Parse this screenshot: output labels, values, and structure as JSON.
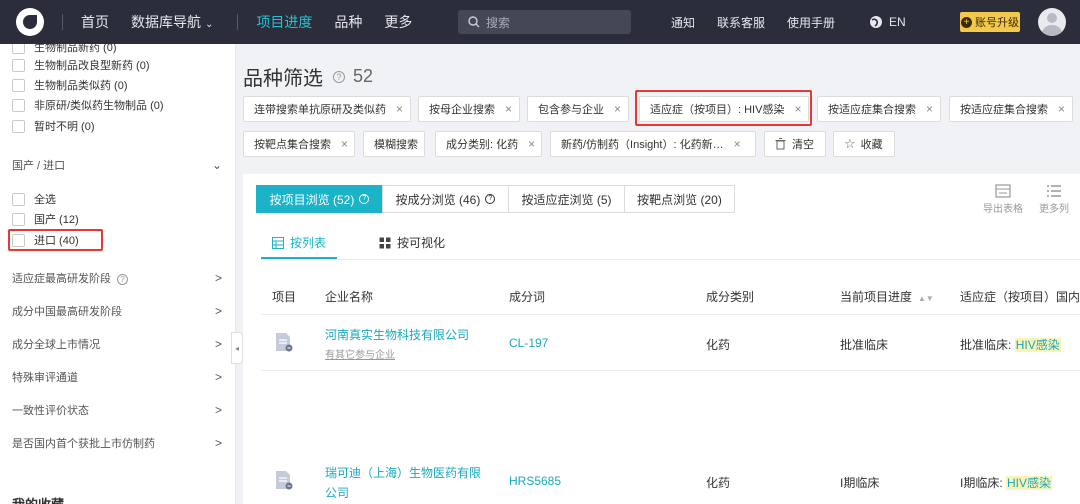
{
  "nav": {
    "items": [
      "首页",
      "数据库导航",
      "项目进度",
      "品种",
      "更多"
    ],
    "search_placeholder": "搜索",
    "right": [
      "通知",
      "联系客服",
      "使用手册"
    ],
    "lang": "EN",
    "upgrade": "账号升级"
  },
  "sidebar": {
    "checkbox_items_top": [
      "生物制品新药 (0)",
      "生物制品改良型新药 (0)",
      "生物制品类似药 (0)",
      "非原研/类似药生物制品 (0)",
      "暂时不明 (0)"
    ],
    "origin_section": "国产 / 进口",
    "origin_items": [
      "全选",
      "国产 (12)",
      "进口 (40)"
    ],
    "sections": [
      "适应症最高研发阶段",
      "成分中国最高研发阶段",
      "成分全球上市情况",
      "特殊审评通道",
      "一致性评价状态",
      "是否国内首个获批上市仿制药"
    ],
    "bottom_partial": "我的收藏"
  },
  "main": {
    "title": "品种筛选",
    "count": "52",
    "tags_row1": [
      "连带搜索单抗原研及类似药",
      "按母企业搜索",
      "包含参与企业",
      "适应症（按项目）: HIV感染",
      "按适应症集合搜索",
      "按适应症集合搜索"
    ],
    "tags_row2": [
      "按靶点集合搜索",
      "模糊搜索",
      "成分类别: 化药",
      "新药/仿制药（Insight）: 化药新…"
    ],
    "clear": "清空",
    "favorite": "收藏",
    "view_tabs": [
      "按项目浏览 (52)",
      "按成分浏览 (46)",
      "按适应症浏览 (5)",
      "按靶点浏览 (20)"
    ],
    "tools": [
      "导出表格",
      "更多列"
    ],
    "sub_tabs": [
      "按列表",
      "按可视化"
    ],
    "columns": [
      "项目",
      "企业名称",
      "成分词",
      "成分类别",
      "当前项目进度",
      "适应症（按项目）国内"
    ],
    "rows": [
      {
        "company": "河南真实生物科技有限公司",
        "sub": "有其它参与企业",
        "ingredient": "CL-197",
        "category": "化药",
        "progress": "批准临床",
        "ind_prefix": "批准临床:",
        "ind": "HIV感染"
      },
      {
        "company_l1": "瑞可迪（上海）生物医药有限",
        "company_l2": "公司",
        "ingredient": "HRS5685",
        "category": "化药",
        "progress": "I期临床",
        "ind_prefix": "I期临床:",
        "ind": "HIV感染"
      }
    ]
  }
}
